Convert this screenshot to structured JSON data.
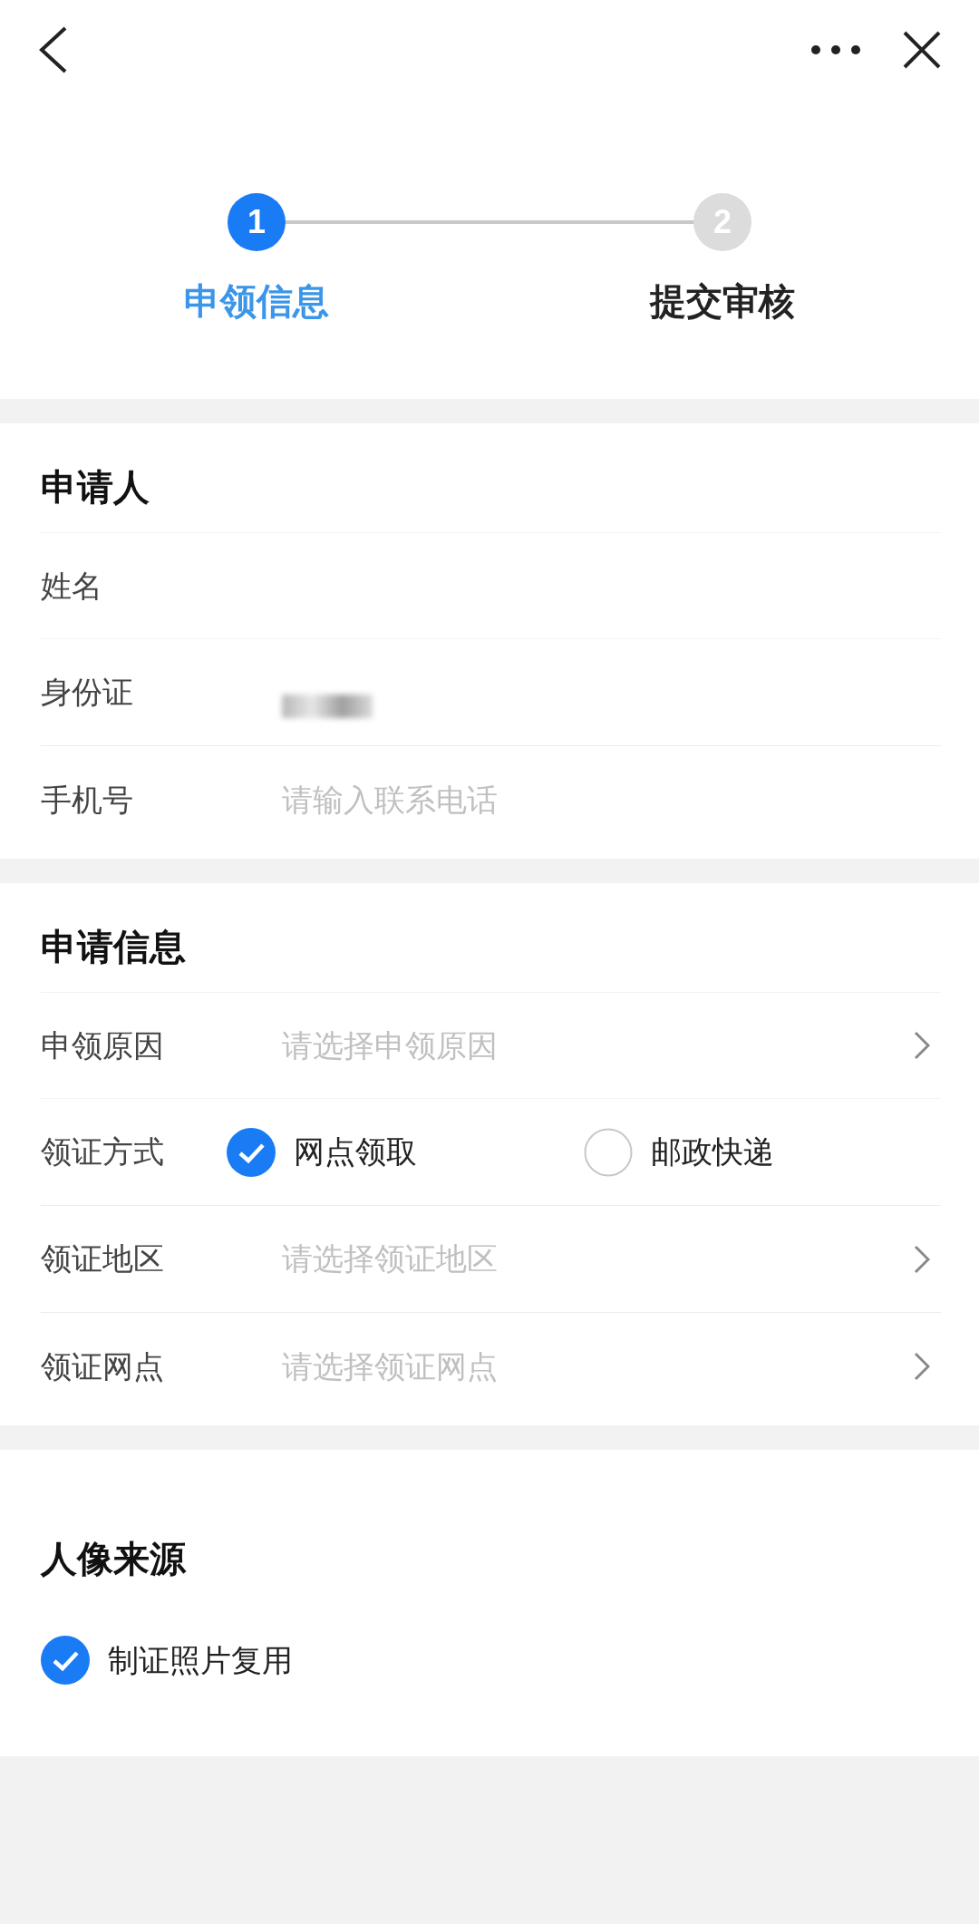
{
  "steps": [
    {
      "number": "1",
      "label": "申领信息",
      "selected": true
    },
    {
      "number": "2",
      "label": "提交审核",
      "selected": false
    }
  ],
  "sections": [
    {
      "title": "申请人",
      "rows": [
        {
          "kind": "text",
          "label": "姓名"
        },
        {
          "kind": "redacted",
          "label": "身份证"
        },
        {
          "kind": "input",
          "label": "手机号",
          "placeholder": "请输入联系电话"
        }
      ]
    },
    {
      "title": "申请信息",
      "rows": [
        {
          "kind": "select",
          "label": "申领原因",
          "placeholder": "请选择申领原因"
        },
        {
          "kind": "radio",
          "label": "领证方式",
          "options": [
            {
              "label": "网点领取",
              "selected": true
            },
            {
              "label": "邮政快递",
              "selected": false
            }
          ]
        },
        {
          "kind": "select",
          "label": "领证地区",
          "placeholder": "请选择领证地区"
        },
        {
          "kind": "select",
          "label": "领证网点",
          "placeholder": "请选择领证网点"
        }
      ]
    }
  ],
  "photo_source": {
    "title": "人像来源",
    "options": [
      {
        "label": "制证照片复用",
        "checked": true
      }
    ]
  }
}
